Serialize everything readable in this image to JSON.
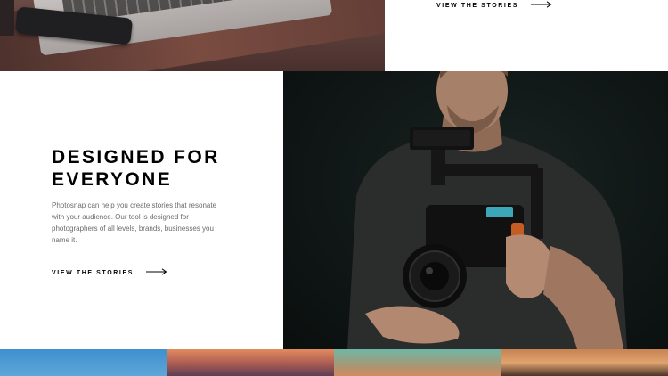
{
  "top": {
    "link_label": "VIEW THE STORIES"
  },
  "feature": {
    "heading": "DESIGNED FOR EVERYONE",
    "body": "Photosnap can help you create stories that resonate with your audience.  Our tool is designed for photographers of all levels, brands, businesses you name it.",
    "link_label": "VIEW THE STORIES"
  },
  "icons": {
    "link_arrow": "arrow-right-icon"
  },
  "colors": {
    "text": "#000000",
    "body_text": "#6b6b6b",
    "background": "#ffffff"
  }
}
